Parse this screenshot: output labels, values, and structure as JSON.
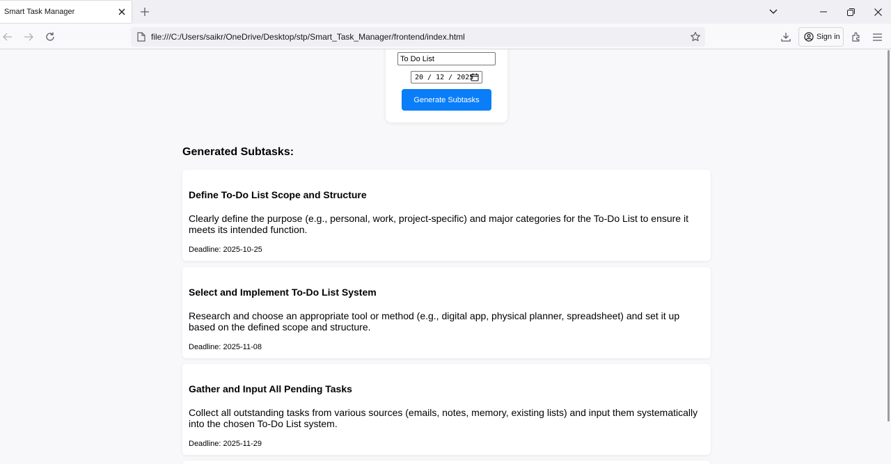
{
  "browser": {
    "tab_title": "Smart Task Manager",
    "url": "file:///C:/Users/saikr/OneDrive/Desktop/stp/Smart_Task_Manager/frontend/index.html",
    "signin_label": "Sign in"
  },
  "form": {
    "task_value": "To Do List",
    "date_value": "20 / 12 / 2025",
    "generate_label": "Generate Subtasks"
  },
  "subtasks_heading": "Generated Subtasks:",
  "subtasks": [
    {
      "title": "Define To-Do List Scope and Structure",
      "description": "Clearly define the purpose (e.g., personal, work, project-specific) and major categories for the To-Do List to ensure it meets its intended function.",
      "deadline": "Deadline: 2025-10-25"
    },
    {
      "title": "Select and Implement To-Do List System",
      "description": "Research and choose an appropriate tool or method (e.g., digital app, physical planner, spreadsheet) and set it up based on the defined scope and structure.",
      "deadline": "Deadline: 2025-11-08"
    },
    {
      "title": "Gather and Input All Pending Tasks",
      "description": "Collect all outstanding tasks from various sources (emails, notes, memory, existing lists) and input them systematically into the chosen To-Do List system.",
      "deadline": "Deadline: 2025-11-29"
    }
  ],
  "colors": {
    "accent_button": "#0a7df8",
    "page_background": "#f8f8fa"
  }
}
